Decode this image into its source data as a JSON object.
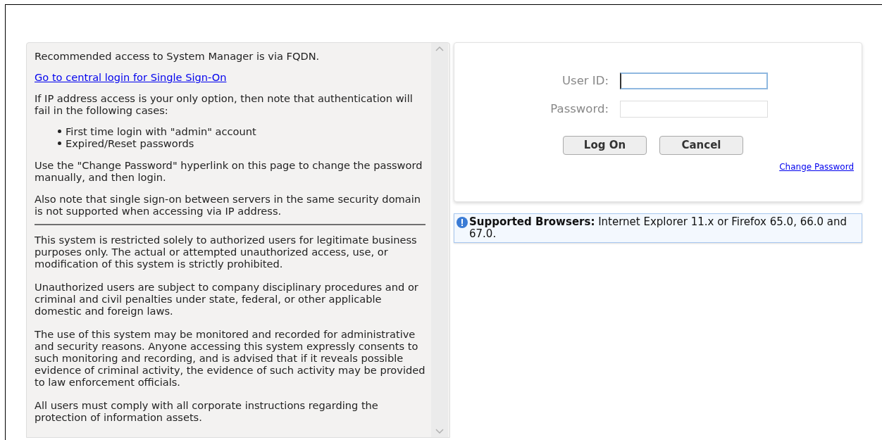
{
  "notice": {
    "intro": "Recommended access to System Manager is via FQDN.",
    "sso_link": "Go to central login for Single Sign-On",
    "ip_note": "If IP address access is your only option, then note that authentication will fail in the following cases:",
    "cases": [
      "First time login with \"admin\" account",
      "Expired/Reset passwords"
    ],
    "paragraphs": [
      "Use the \"Change Password\" hyperlink on this page to change the password manually, and then login.",
      "Also note that single sign-on between servers in the same security domain is not supported when accessing via IP address."
    ],
    "legal": [
      "This system is restricted solely to authorized users for legitimate business purposes only. The actual or attempted unauthorized access, use, or modification of this system is strictly prohibited.",
      "Unauthorized users are subject to company disciplinary procedures and or criminal and civil penalties under state, federal, or other applicable domestic and foreign laws.",
      "The use of this system may be monitored and recorded for administrative and security reasons. Anyone accessing this system expressly consents to such monitoring and recording, and is advised that if it reveals possible evidence of criminal activity, the evidence of such activity may be provided to law enforcement officials.",
      "All users must comply with all corporate instructions regarding the protection of information assets."
    ]
  },
  "login": {
    "fields": [
      {
        "label": "User ID:",
        "focused": true
      },
      {
        "label": "Password:",
        "focused": false
      }
    ],
    "buttons": [
      "Log On",
      "Cancel"
    ],
    "change_password_link": "Change Password"
  },
  "browsers_note": "**Supported Browsers:** Internet Explorer 11.x or Firefox 65.0, 66.0 and 67.0."
}
